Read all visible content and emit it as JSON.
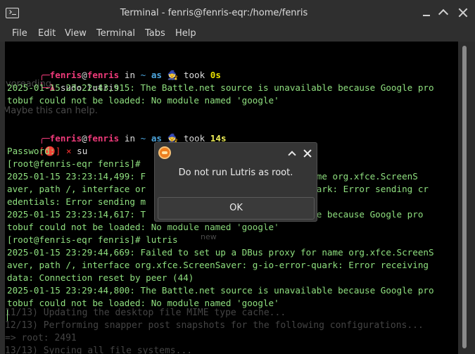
{
  "window": {
    "title": "Terminal - fenris@fenris-eqr:/home/fenris"
  },
  "menu": [
    "File",
    "Edit",
    "View",
    "Terminal",
    "Tabs",
    "Help"
  ],
  "terminal": {
    "prompt1": {
      "user": "fenris",
      "at": "@",
      "host": "fenris",
      "in": "in",
      "dir": "~",
      "as": "as",
      "emoji": "🧙",
      "took_label": "took",
      "took": "0s"
    },
    "cmd1": {
      "symbol": "λ",
      "command": "sudo lutris"
    },
    "log1": "2025-01-15 23:22:43,915: The Battle.net source is unavailable because Google pro",
    "log1b": "tobuf could not be loaded: No module named 'google'",
    "prompt2": {
      "user": "fenris",
      "at": "@",
      "host": "fenris",
      "in": "in",
      "dir": "~",
      "as": "as",
      "emoji": "🧙",
      "took_label": "took",
      "took": "14s"
    },
    "cmd2": {
      "bracket_open": "[",
      "status": "🔴",
      "bracket_close": "]",
      "cross": "×",
      "command": "su"
    },
    "password": "Password:",
    "root1": "[root@fenris-eqr fenris]#",
    "log2": "2025-01-15 23:23:14,499: F                          for name org.xfce.ScreenS",
    "log2b": "aver, path /, interface or                          ror-quark: Error sending cr",
    "log2c": "edentials: Error sending m",
    "log3": "2025-01-15 23:23:14,617: T                          ailable because Google pro",
    "log3b": "tobuf could not be loaded: No module named 'google'",
    "root2": "[root@fenris-eqr fenris]# lutris",
    "log4": "2025-01-15 23:29:44,669: Failed to set up a DBus proxy for name org.xfce.ScreenS",
    "log4b": "aver, path /, interface org.xfce.ScreenSaver: g-io-error-quark: Error receiving",
    "log4c": "data: Connection reset by peer (44)",
    "log5": "2025-01-15 23:29:44,800: The Battle.net source is unavailable because Google pro",
    "log5b": "tobuf could not be loaded: No module named 'google'"
  },
  "background_ghost": {
    "top_left": "voreading",
    "maybe": "Maybe this can help.",
    "new": "new",
    "mime": "11/13) Updating the desktop file MIME type cache...",
    "snapper": "12/13) Performing snapper post snapshots for the following configurations...",
    "root_pid": "=> root: 2491",
    "sync": "13/13) Syncing all file systems..."
  },
  "dialog": {
    "message": "Do not run Lutris as root.",
    "ok_label": "OK"
  },
  "icons": {
    "app": "terminal-icon",
    "dialog": "lutris-icon"
  },
  "colors": {
    "terminal_bg": "#000000",
    "text": "#8fe07f",
    "user": "#ef3a7a",
    "dir": "#4ea8e0",
    "took": "#e8e000"
  }
}
